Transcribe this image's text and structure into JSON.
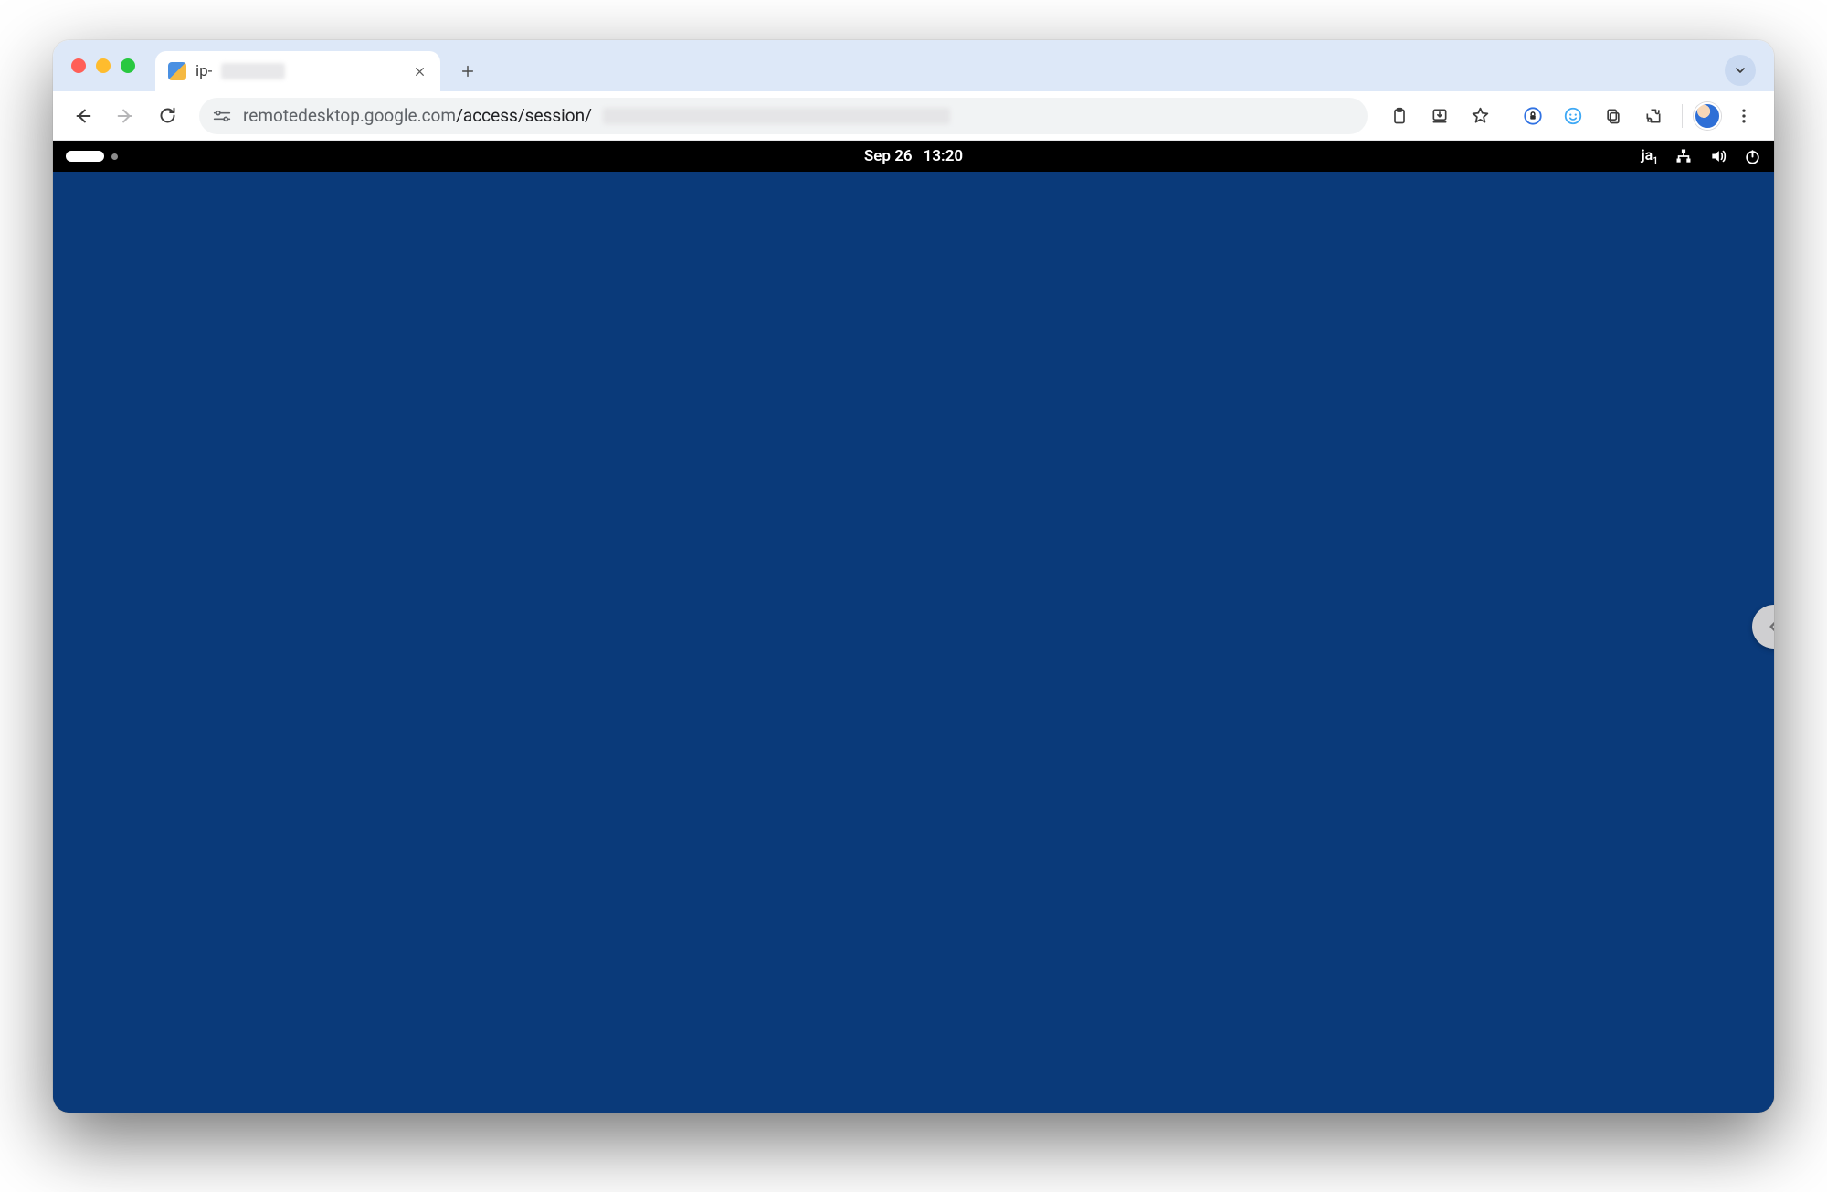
{
  "browser": {
    "tab": {
      "title_prefix": "ip-",
      "close_label": "Close tab",
      "favicon_name": "remote-desktop-favicon"
    },
    "new_tab_label": "New tab",
    "tab_dropdown_label": "Search tabs",
    "nav": {
      "back": "Back",
      "forward": "Forward",
      "reload": "Reload"
    },
    "omnibox": {
      "site_info": "View site information",
      "url_host": "remotedesktop.google.com",
      "url_path": "/access/session/"
    },
    "actions": {
      "clipboard": "Clipboard",
      "downloads": "Downloads",
      "bookmark": "Bookmark this tab",
      "ext_privacy": "Privacy extension",
      "ext_face": "Extension",
      "copy": "Copy",
      "extensions": "Extensions",
      "profile": "Profile",
      "menu": "Customize and control"
    }
  },
  "remote": {
    "topbar": {
      "activities": "Activities",
      "date": "Sep 26",
      "time": "13:20",
      "ime": "ja",
      "ime_sub": "1",
      "network": "Wired connected",
      "volume": "Volume",
      "power": "Power"
    },
    "side_handle": "Open panel"
  },
  "colors": {
    "tabstrip": "#dde8f8",
    "desktop": "#0a3a7a",
    "topbar": "#000000"
  }
}
